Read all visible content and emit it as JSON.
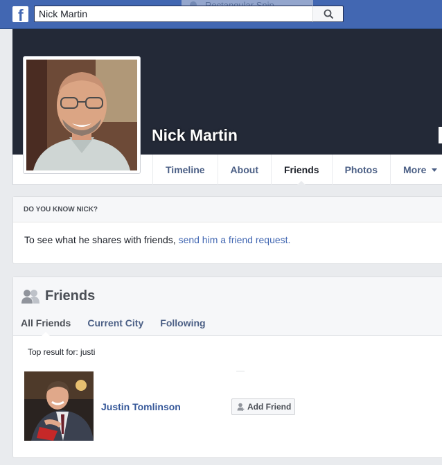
{
  "topbar": {
    "logo_letter": "f",
    "search_value": "Nick Martin",
    "ghost_text": "Rectangular Snip"
  },
  "profile": {
    "name": "Nick Martin",
    "tabs": [
      {
        "label": "Timeline"
      },
      {
        "label": "About"
      },
      {
        "label": "Friends"
      },
      {
        "label": "Photos"
      },
      {
        "label": "More"
      }
    ]
  },
  "know_card": {
    "heading": "DO YOU KNOW NICK?",
    "text": "To see what he shares with friends, ",
    "link": "send him a friend request."
  },
  "friends_card": {
    "title": "Friends",
    "subtabs": [
      {
        "label": "All Friends"
      },
      {
        "label": "Current City"
      },
      {
        "label": "Following"
      }
    ],
    "top_result": "Top result for: justi",
    "result": {
      "name": "Justin Tomlinson",
      "button": "Add Friend"
    }
  },
  "colors": {
    "topbar": "#4267b2",
    "cover": "#232937",
    "link": "#4267b2",
    "tab_text": "#4b5f85"
  },
  "icons": [
    "facebook-logo-icon",
    "search-icon",
    "friends-icon",
    "add-friend-icon",
    "chevron-down-icon"
  ]
}
